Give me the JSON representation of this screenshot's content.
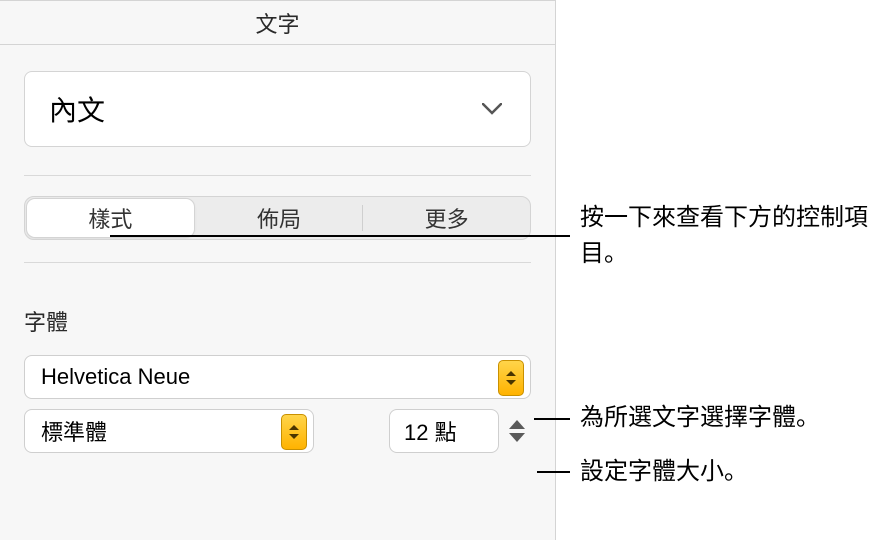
{
  "panel": {
    "title": "文字"
  },
  "style_selector": {
    "value": "內文"
  },
  "tabs": {
    "style": "樣式",
    "layout": "佈局",
    "more": "更多"
  },
  "font_section": {
    "label": "字體",
    "family": "Helvetica Neue",
    "variant": "標準體",
    "size": "12 點"
  },
  "callouts": {
    "tabs": "按一下來查看下方的控制項目。",
    "font_family": "為所選文字選擇字體。",
    "font_size": "設定字體大小。"
  }
}
